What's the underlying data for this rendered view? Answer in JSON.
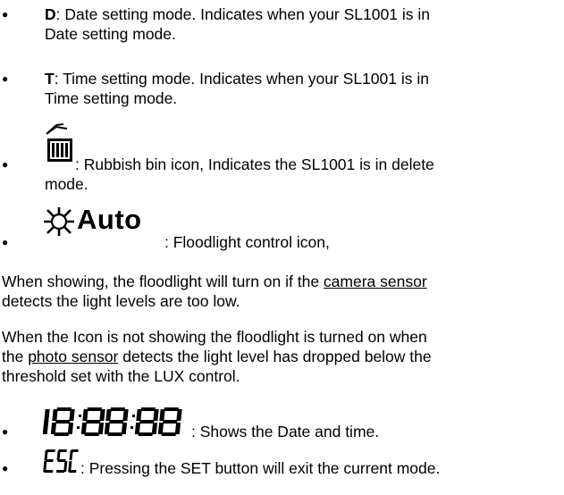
{
  "items": [
    {
      "key": "D",
      "text_line1": ": Date setting mode. Indicates when your SL1001 is in",
      "text_line2": "Date setting mode."
    },
    {
      "key": "T",
      "text_line1": ": Time setting mode. Indicates when your SL1001 is in",
      "text_line2": "Time setting mode."
    },
    {
      "icon": "rubbish-bin-icon",
      "text_line1": ": Rubbish bin icon, Indicates the SL1001 is in delete",
      "text_line2": "mode."
    },
    {
      "icon": "floodlight-auto-icon",
      "icon_word": "Auto",
      "text_line1": ": Floodlight control icon,"
    }
  ],
  "para1": {
    "line1_a": "When showing, the floodlight will turn on if the ",
    "line1_u": "camera sensor",
    "line2": "detects the light levels are too low."
  },
  "para2": {
    "line1": "When the Icon is not showing the floodlight is turned on when",
    "line2_a": "the ",
    "line2_u": "photo sensor",
    "line2_b": " detects the light level has dropped below the",
    "line3": "threshold set with the LUX control."
  },
  "items2": [
    {
      "icon": "seven-segment-datetime-icon",
      "text": ": Shows the Date and time."
    },
    {
      "icon": "esc-segment-icon",
      "text": ": Pressing the SET button will exit the current mode."
    }
  ]
}
